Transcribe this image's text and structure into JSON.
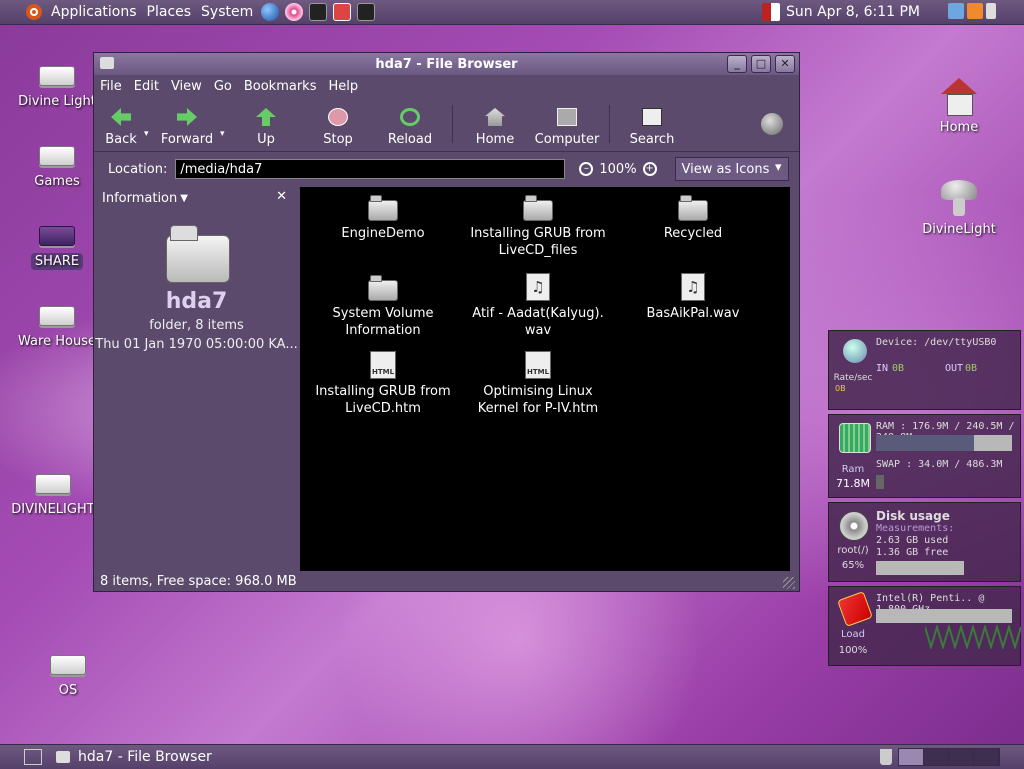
{
  "top_panel": {
    "menus": [
      "Applications",
      "Places",
      "System"
    ],
    "clock": "Sun Apr  8,  6:11 PM"
  },
  "desktop_icons": [
    {
      "label": "Divine Light"
    },
    {
      "label": "Games"
    },
    {
      "label": "SHARE"
    },
    {
      "label": "Ware House"
    },
    {
      "label": "DIVINELIGHT"
    },
    {
      "label": "OS"
    },
    {
      "label": "Home"
    },
    {
      "label": "DivineLight"
    }
  ],
  "window": {
    "title": "hda7 - File Browser",
    "menu": [
      "File",
      "Edit",
      "View",
      "Go",
      "Bookmarks",
      "Help"
    ],
    "toolbar": {
      "back": "Back",
      "forward": "Forward",
      "up": "Up",
      "stop": "Stop",
      "reload": "Reload",
      "home": "Home",
      "computer": "Computer",
      "search": "Search"
    },
    "location": {
      "label": "Location:",
      "value": "/media/hda7",
      "zoom": "100%",
      "view_mode": "View as Icons"
    },
    "sidebar": {
      "title": "Information",
      "name": "hda7",
      "kind": "folder, 8 items",
      "date": "Thu 01 Jan 1970 05:00:00 KA..."
    },
    "files": [
      {
        "line1": "EngineDemo",
        "line2": "",
        "type": "folder"
      },
      {
        "line1": "Installing GRUB from",
        "line2": "LiveCD_files",
        "type": "folder"
      },
      {
        "line1": "Recycled",
        "line2": "",
        "type": "folder"
      },
      {
        "line1": "System Volume",
        "line2": "Information",
        "type": "folder"
      },
      {
        "line1": "Atif - Aadat(Kalyug).",
        "line2": "wav",
        "type": "audio"
      },
      {
        "line1": "BasAikPal.wav",
        "line2": "",
        "type": "audio"
      },
      {
        "line1": "Installing GRUB from",
        "line2": "LiveCD.htm",
        "type": "html"
      },
      {
        "line1": "Optimising Linux",
        "line2": "Kernel for P-IV.htm",
        "type": "html"
      }
    ],
    "status": "8 items, Free space: 968.0 MB"
  },
  "monitors": {
    "net": {
      "device": "Device: /dev/ttyUSB0",
      "in_label": "IN",
      "in_val": "0B",
      "out_label": "OUT",
      "out_val": "0B",
      "rate": "Rate/sec",
      "rate_val": "0B"
    },
    "ram": {
      "ram_text": "RAM : 176.9M / 240.5M / 248.8M",
      "swap_text": "SWAP : 34.0M / 486.3M",
      "label": "Ram",
      "value": "71.8M",
      "ram_fill": 0.72,
      "swap_fill": 0.07
    },
    "disk": {
      "title": "Disk usage",
      "subtitle": "Measurements:",
      "used": "2.63 GB used",
      "free": "1.36 GB free",
      "mount": "root(/)",
      "percent": "65%",
      "fill": 0.65
    },
    "cpu": {
      "name": "Intel(R) Penti.. @ 1.800 GHz",
      "label": "Load",
      "value": "100%"
    }
  },
  "bottom_panel": {
    "task": "hda7 - File Browser"
  }
}
